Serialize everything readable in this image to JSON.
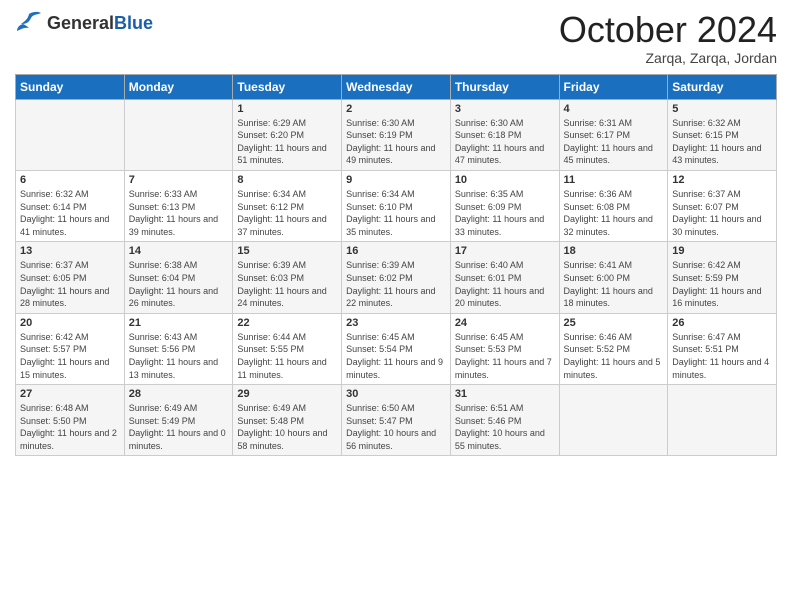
{
  "header": {
    "logo_general": "General",
    "logo_blue": "Blue",
    "month": "October 2024",
    "location": "Zarqa, Zarqa, Jordan"
  },
  "weekdays": [
    "Sunday",
    "Monday",
    "Tuesday",
    "Wednesday",
    "Thursday",
    "Friday",
    "Saturday"
  ],
  "weeks": [
    [
      {
        "day": "",
        "sunrise": "",
        "sunset": "",
        "daylight": ""
      },
      {
        "day": "",
        "sunrise": "",
        "sunset": "",
        "daylight": ""
      },
      {
        "day": "1",
        "sunrise": "Sunrise: 6:29 AM",
        "sunset": "Sunset: 6:20 PM",
        "daylight": "Daylight: 11 hours and 51 minutes."
      },
      {
        "day": "2",
        "sunrise": "Sunrise: 6:30 AM",
        "sunset": "Sunset: 6:19 PM",
        "daylight": "Daylight: 11 hours and 49 minutes."
      },
      {
        "day": "3",
        "sunrise": "Sunrise: 6:30 AM",
        "sunset": "Sunset: 6:18 PM",
        "daylight": "Daylight: 11 hours and 47 minutes."
      },
      {
        "day": "4",
        "sunrise": "Sunrise: 6:31 AM",
        "sunset": "Sunset: 6:17 PM",
        "daylight": "Daylight: 11 hours and 45 minutes."
      },
      {
        "day": "5",
        "sunrise": "Sunrise: 6:32 AM",
        "sunset": "Sunset: 6:15 PM",
        "daylight": "Daylight: 11 hours and 43 minutes."
      }
    ],
    [
      {
        "day": "6",
        "sunrise": "Sunrise: 6:32 AM",
        "sunset": "Sunset: 6:14 PM",
        "daylight": "Daylight: 11 hours and 41 minutes."
      },
      {
        "day": "7",
        "sunrise": "Sunrise: 6:33 AM",
        "sunset": "Sunset: 6:13 PM",
        "daylight": "Daylight: 11 hours and 39 minutes."
      },
      {
        "day": "8",
        "sunrise": "Sunrise: 6:34 AM",
        "sunset": "Sunset: 6:12 PM",
        "daylight": "Daylight: 11 hours and 37 minutes."
      },
      {
        "day": "9",
        "sunrise": "Sunrise: 6:34 AM",
        "sunset": "Sunset: 6:10 PM",
        "daylight": "Daylight: 11 hours and 35 minutes."
      },
      {
        "day": "10",
        "sunrise": "Sunrise: 6:35 AM",
        "sunset": "Sunset: 6:09 PM",
        "daylight": "Daylight: 11 hours and 33 minutes."
      },
      {
        "day": "11",
        "sunrise": "Sunrise: 6:36 AM",
        "sunset": "Sunset: 6:08 PM",
        "daylight": "Daylight: 11 hours and 32 minutes."
      },
      {
        "day": "12",
        "sunrise": "Sunrise: 6:37 AM",
        "sunset": "Sunset: 6:07 PM",
        "daylight": "Daylight: 11 hours and 30 minutes."
      }
    ],
    [
      {
        "day": "13",
        "sunrise": "Sunrise: 6:37 AM",
        "sunset": "Sunset: 6:05 PM",
        "daylight": "Daylight: 11 hours and 28 minutes."
      },
      {
        "day": "14",
        "sunrise": "Sunrise: 6:38 AM",
        "sunset": "Sunset: 6:04 PM",
        "daylight": "Daylight: 11 hours and 26 minutes."
      },
      {
        "day": "15",
        "sunrise": "Sunrise: 6:39 AM",
        "sunset": "Sunset: 6:03 PM",
        "daylight": "Daylight: 11 hours and 24 minutes."
      },
      {
        "day": "16",
        "sunrise": "Sunrise: 6:39 AM",
        "sunset": "Sunset: 6:02 PM",
        "daylight": "Daylight: 11 hours and 22 minutes."
      },
      {
        "day": "17",
        "sunrise": "Sunrise: 6:40 AM",
        "sunset": "Sunset: 6:01 PM",
        "daylight": "Daylight: 11 hours and 20 minutes."
      },
      {
        "day": "18",
        "sunrise": "Sunrise: 6:41 AM",
        "sunset": "Sunset: 6:00 PM",
        "daylight": "Daylight: 11 hours and 18 minutes."
      },
      {
        "day": "19",
        "sunrise": "Sunrise: 6:42 AM",
        "sunset": "Sunset: 5:59 PM",
        "daylight": "Daylight: 11 hours and 16 minutes."
      }
    ],
    [
      {
        "day": "20",
        "sunrise": "Sunrise: 6:42 AM",
        "sunset": "Sunset: 5:57 PM",
        "daylight": "Daylight: 11 hours and 15 minutes."
      },
      {
        "day": "21",
        "sunrise": "Sunrise: 6:43 AM",
        "sunset": "Sunset: 5:56 PM",
        "daylight": "Daylight: 11 hours and 13 minutes."
      },
      {
        "day": "22",
        "sunrise": "Sunrise: 6:44 AM",
        "sunset": "Sunset: 5:55 PM",
        "daylight": "Daylight: 11 hours and 11 minutes."
      },
      {
        "day": "23",
        "sunrise": "Sunrise: 6:45 AM",
        "sunset": "Sunset: 5:54 PM",
        "daylight": "Daylight: 11 hours and 9 minutes."
      },
      {
        "day": "24",
        "sunrise": "Sunrise: 6:45 AM",
        "sunset": "Sunset: 5:53 PM",
        "daylight": "Daylight: 11 hours and 7 minutes."
      },
      {
        "day": "25",
        "sunrise": "Sunrise: 6:46 AM",
        "sunset": "Sunset: 5:52 PM",
        "daylight": "Daylight: 11 hours and 5 minutes."
      },
      {
        "day": "26",
        "sunrise": "Sunrise: 6:47 AM",
        "sunset": "Sunset: 5:51 PM",
        "daylight": "Daylight: 11 hours and 4 minutes."
      }
    ],
    [
      {
        "day": "27",
        "sunrise": "Sunrise: 6:48 AM",
        "sunset": "Sunset: 5:50 PM",
        "daylight": "Daylight: 11 hours and 2 minutes."
      },
      {
        "day": "28",
        "sunrise": "Sunrise: 6:49 AM",
        "sunset": "Sunset: 5:49 PM",
        "daylight": "Daylight: 11 hours and 0 minutes."
      },
      {
        "day": "29",
        "sunrise": "Sunrise: 6:49 AM",
        "sunset": "Sunset: 5:48 PM",
        "daylight": "Daylight: 10 hours and 58 minutes."
      },
      {
        "day": "30",
        "sunrise": "Sunrise: 6:50 AM",
        "sunset": "Sunset: 5:47 PM",
        "daylight": "Daylight: 10 hours and 56 minutes."
      },
      {
        "day": "31",
        "sunrise": "Sunrise: 6:51 AM",
        "sunset": "Sunset: 5:46 PM",
        "daylight": "Daylight: 10 hours and 55 minutes."
      },
      {
        "day": "",
        "sunrise": "",
        "sunset": "",
        "daylight": ""
      },
      {
        "day": "",
        "sunrise": "",
        "sunset": "",
        "daylight": ""
      }
    ]
  ]
}
